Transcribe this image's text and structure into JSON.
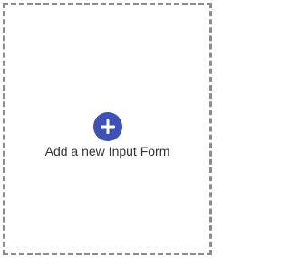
{
  "card": {
    "label": "Add a new Input Form",
    "icon": "plus-icon",
    "accent_color": "#3f51b5",
    "border_color": "#8c8c8c"
  }
}
